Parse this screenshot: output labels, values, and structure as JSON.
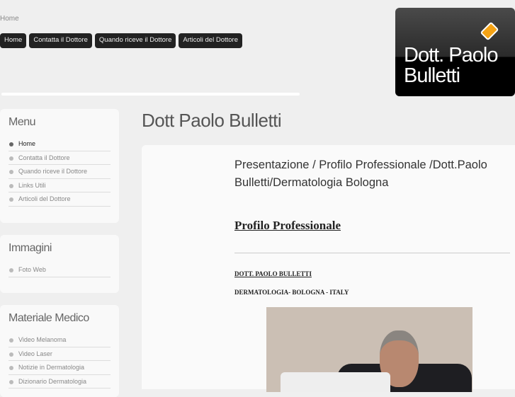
{
  "breadcrumb": "Home",
  "nav": [
    "Home",
    "Contatta il Dottore",
    "Quando riceve il Dottore",
    "Articoli del Dottore"
  ],
  "logo": {
    "line1": "Dott. Paolo",
    "line2": "Bulletti"
  },
  "sidebar": [
    {
      "title": "Menu",
      "items": [
        "Home",
        "Contatta il Dottore",
        "Quando riceve il Dottore",
        "Links Utili",
        "Articoli del Dottore"
      ]
    },
    {
      "title": "Immagini",
      "items": [
        "Foto Web"
      ]
    },
    {
      "title": "Materiale Medico",
      "items": [
        "Video Melanoma",
        "Video Laser",
        "Notizie in Dermatologia",
        "Dizionario Dermatologia"
      ]
    }
  ],
  "page_title": "Dott Paolo Bulletti",
  "content": {
    "heading": "Presentazione / Profilo Professionale /Dott.Paolo Bulletti/Dermatologia Bologna",
    "subheading": "Profilo Professionale",
    "name": "DOTT. PAOLO BULLETTI",
    "specialty": "DERMATOLOGIA- BOLOGNA - ITALY"
  }
}
